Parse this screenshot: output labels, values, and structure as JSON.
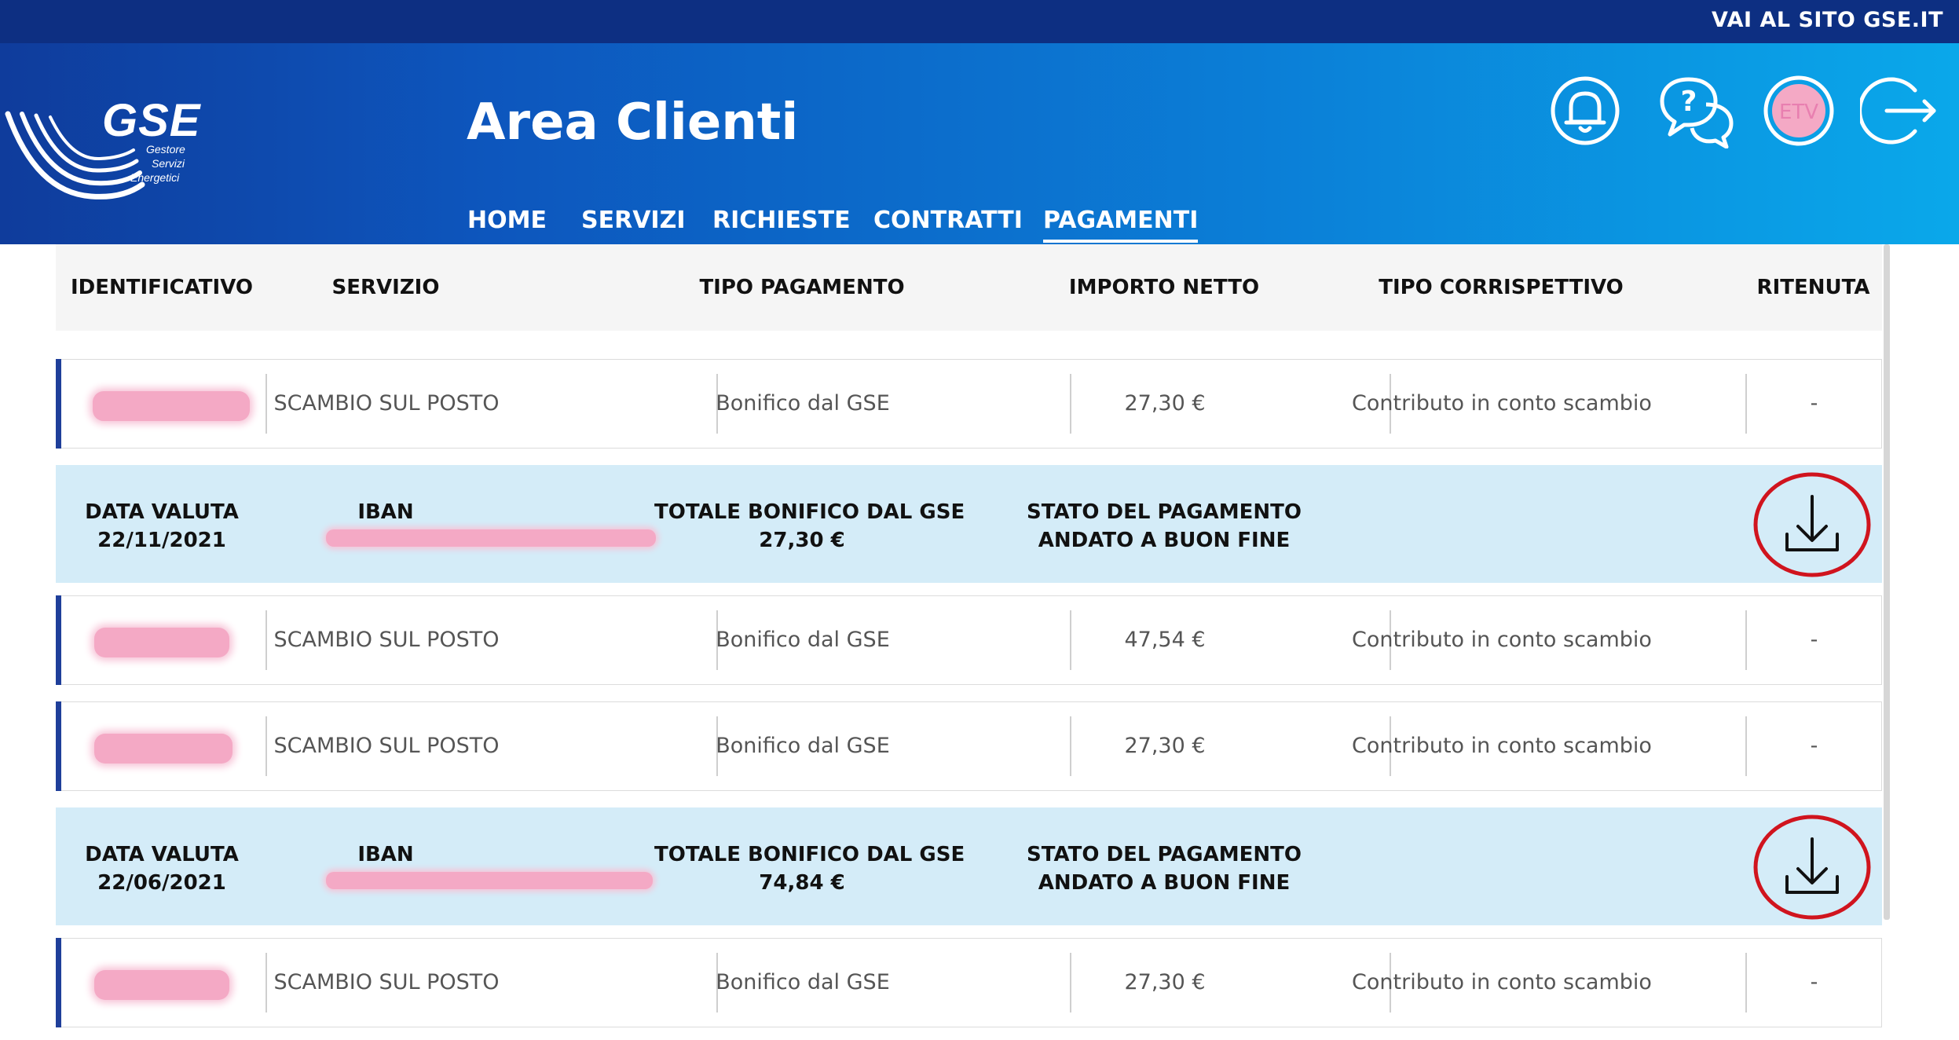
{
  "topbar": {
    "link": "VAI AL SITO GSE.IT"
  },
  "logo": {
    "brand": "GSE",
    "line1": "Gestore",
    "line2": "Servizi",
    "line3": "Energetici"
  },
  "header": {
    "title": "Area Clienti",
    "nav": [
      {
        "label": "HOME",
        "active": false
      },
      {
        "label": "SERVIZI",
        "active": false
      },
      {
        "label": "RICHIESTE",
        "active": false
      },
      {
        "label": "CONTRATTI",
        "active": false
      },
      {
        "label": "PAGAMENTI",
        "active": true
      }
    ],
    "icons": [
      "bell-icon",
      "help-chat-icon",
      "user-avatar",
      "logout-icon"
    ],
    "avatar_initials": "ETV"
  },
  "table": {
    "columns": [
      "IDENTIFICATIVO",
      "SERVIZIO",
      "TIPO PAGAMENTO",
      "IMPORTO NETTO",
      "TIPO CORRISPETTIVO",
      "RITENUTA"
    ],
    "rows": [
      {
        "servizio": "SCAMBIO SUL POSTO",
        "tipo": "Bonifico dal GSE",
        "importo": "27,30 €",
        "corrispettivo": "Contributo in conto scambio",
        "ritenuta": "-"
      },
      {
        "servizio": "SCAMBIO SUL POSTO",
        "tipo": "Bonifico dal GSE",
        "importo": "47,54 €",
        "corrispettivo": "Contributo in conto scambio",
        "ritenuta": "-"
      },
      {
        "servizio": "SCAMBIO SUL POSTO",
        "tipo": "Bonifico dal GSE",
        "importo": "27,30 €",
        "corrispettivo": "Contributo in conto scambio",
        "ritenuta": "-"
      },
      {
        "servizio": "SCAMBIO SUL POSTO",
        "tipo": "Bonifico dal GSE",
        "importo": "27,30 €",
        "corrispettivo": "Contributo in conto scambio",
        "ritenuta": "-"
      }
    ],
    "details": [
      {
        "data_label": "DATA VALUTA",
        "data_value": "22/11/2021",
        "iban_label": "IBAN",
        "totale_label": "TOTALE BONIFICO DAL GSE",
        "totale_value": "27,30 €",
        "stato_label": "STATO DEL PAGAMENTO",
        "stato_value": "ANDATO A BUON FINE"
      },
      {
        "data_label": "DATA VALUTA",
        "data_value": "22/06/2021",
        "iban_label": "IBAN",
        "totale_label": "TOTALE BONIFICO DAL GSE",
        "totale_value": "74,84 €",
        "stato_label": "STATO DEL PAGAMENTO",
        "stato_value": "ANDATO A BUON FINE"
      }
    ]
  },
  "colors": {
    "header_dark": "#0d2f82",
    "accent_blue": "#1f3f9a",
    "detail_bg": "#d4ecf8",
    "highlight_circle": "#d0141e"
  }
}
